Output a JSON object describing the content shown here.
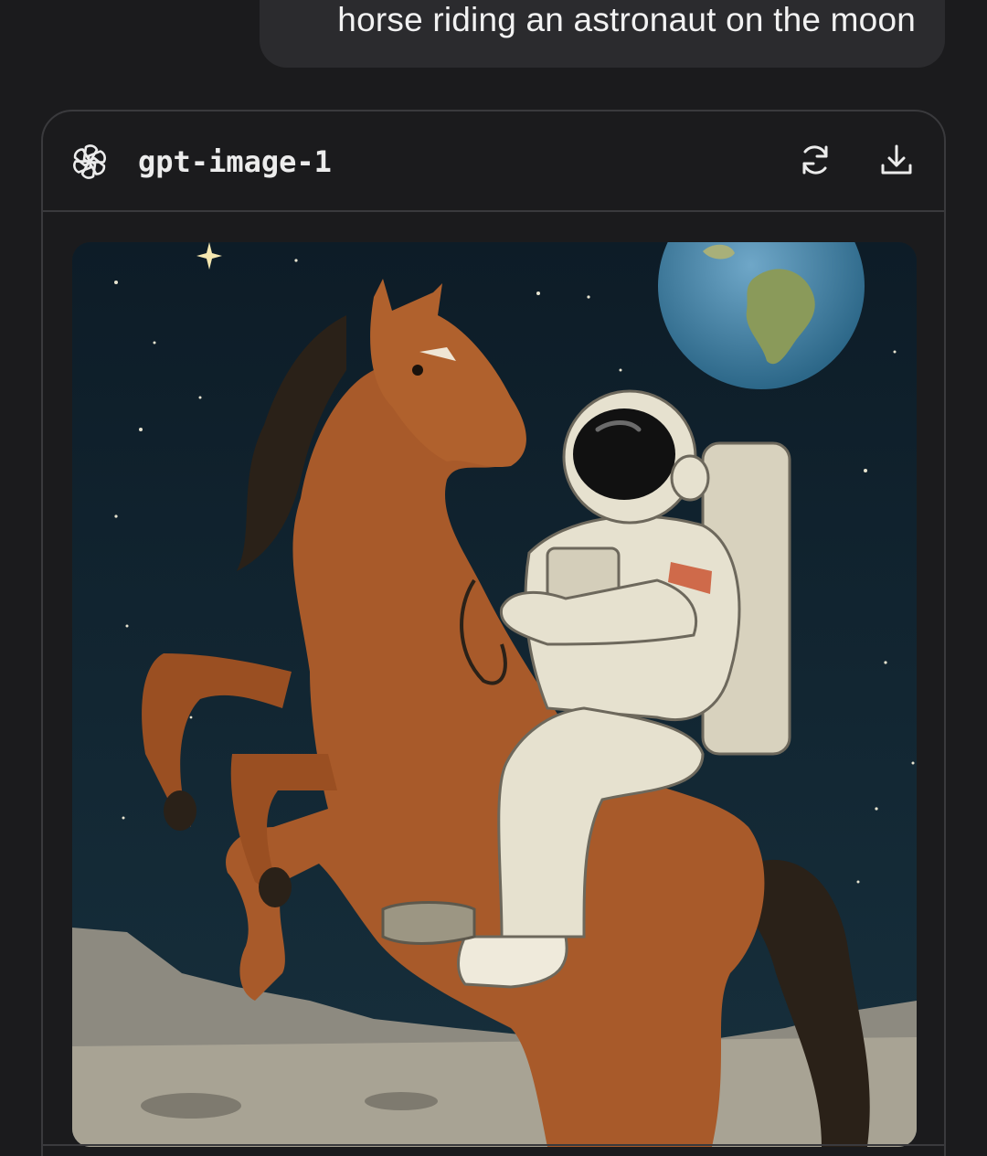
{
  "conversation": {
    "user_prompt": "horse riding an astronaut on the moon"
  },
  "result": {
    "model_name": "gpt-image-1",
    "model_icon": "openai-logo-icon",
    "actions": {
      "regenerate_icon": "refresh-icon",
      "download_icon": "download-icon"
    },
    "image": {
      "description_icon": "generated-image"
    }
  },
  "colors": {
    "background": "#1b1b1d",
    "bubble": "#2b2b2e",
    "card_border": "#3a3a3d",
    "text": "#ececec",
    "sky": "#10202c",
    "horse": "#a85a2a",
    "suit": "#e6e1cf",
    "moon_ground": "#a8a394"
  }
}
